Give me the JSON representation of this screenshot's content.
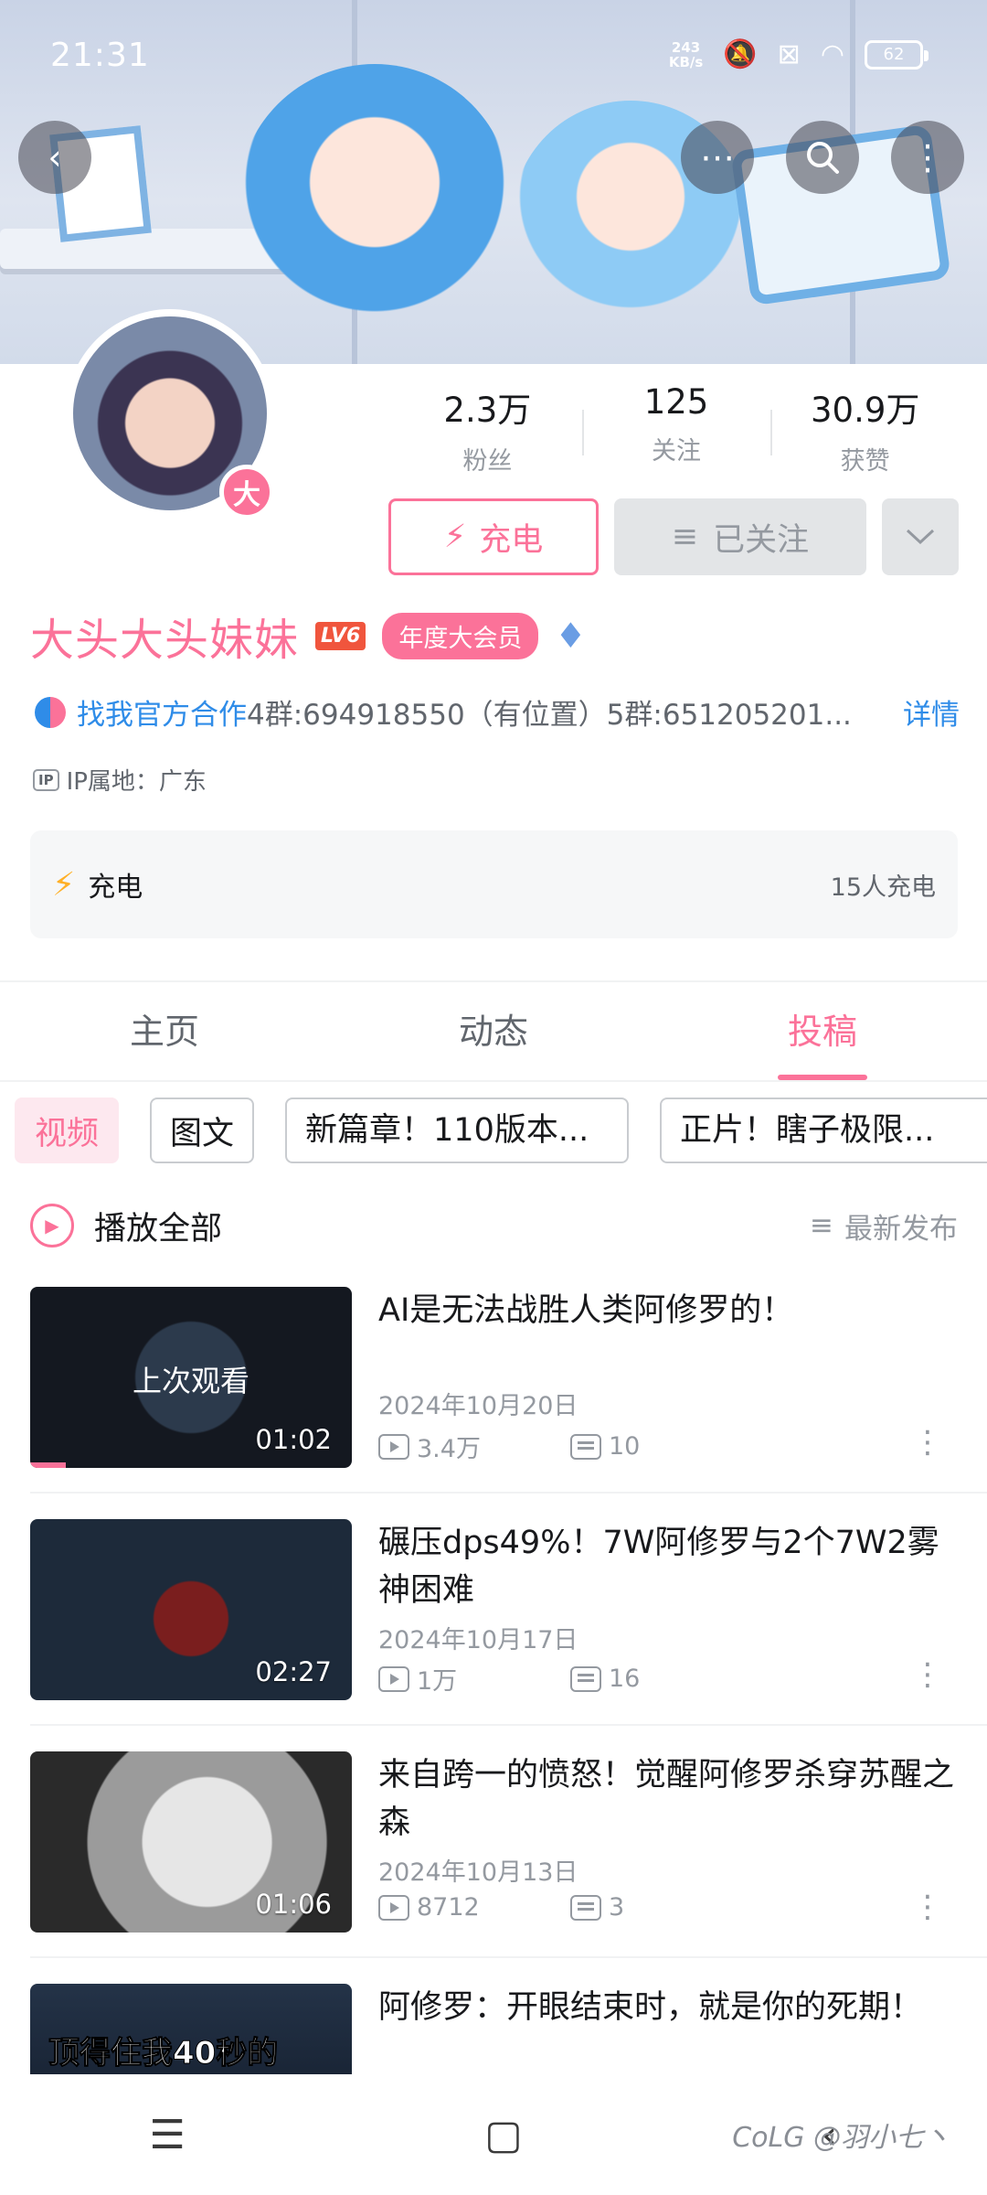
{
  "status_bar": {
    "time": "21:31",
    "net_speed_value": "243",
    "net_speed_unit": "KB/s",
    "battery": "62"
  },
  "profile": {
    "avatar_badge": "大",
    "stats": [
      {
        "value": "2.3万",
        "label": "粉丝"
      },
      {
        "value": "125",
        "label": "关注"
      },
      {
        "value": "30.9万",
        "label": "获赞"
      }
    ],
    "charge_button": "充电",
    "followed_button": "已关注",
    "username": "大头大头妹妹",
    "level_badge": "LV6",
    "vip_badge": "年度大会员",
    "bio_link": "找我官方合作",
    "bio_text": "4群:694918550（有位置）5群:651205201...",
    "bio_detail": "详情",
    "ip_icon": "IP",
    "ip_location": "IP属地：广东",
    "charge_card": {
      "title": "充电",
      "count": "15人充电"
    }
  },
  "tabs": [
    {
      "label": "主页",
      "active": false
    },
    {
      "label": "动态",
      "active": false
    },
    {
      "label": "投稿",
      "active": true
    }
  ],
  "chips": [
    "视频",
    "图文",
    "新篇章！110版本...",
    "正片！瞎子极限..."
  ],
  "play_all": {
    "label": "播放全部",
    "sort": "最新发布"
  },
  "videos": [
    {
      "title": "AI是无法战胜人类阿修罗的！",
      "date": "2024年10月20日",
      "views": "3.4万",
      "danmaku": "10",
      "duration": "01:02",
      "overlay": "上次观看",
      "progress": 0.11
    },
    {
      "title": "碾压dps49%！7W阿修罗与2个7W2雾神困难",
      "date": "2024年10月17日",
      "views": "1万",
      "danmaku": "16",
      "duration": "02:27"
    },
    {
      "title": "来自跨一的愤怒！觉醒阿修罗杀穿苏醒之森",
      "date": "2024年10月13日",
      "views": "8712",
      "danmaku": "3",
      "duration": "01:06"
    },
    {
      "title": "阿修罗：开眼结束时，就是你的死期！",
      "thumb_text": "顶得住我40秒的"
    }
  ],
  "watermark": "CoLG @羽小七丶",
  "colors": {
    "accent": "#fb7299",
    "link": "#2f8ce8",
    "text_secondary": "#9499a0"
  },
  "icons": [
    "back-icon",
    "message-icon",
    "search-icon",
    "more-icon",
    "lightning-icon",
    "list-icon",
    "chevron-down-icon",
    "play-circle-icon",
    "sort-icon",
    "play-count-icon",
    "danmaku-icon",
    "more-vertical-icon",
    "menu-icon",
    "home-icon",
    "back-gesture-icon"
  ]
}
